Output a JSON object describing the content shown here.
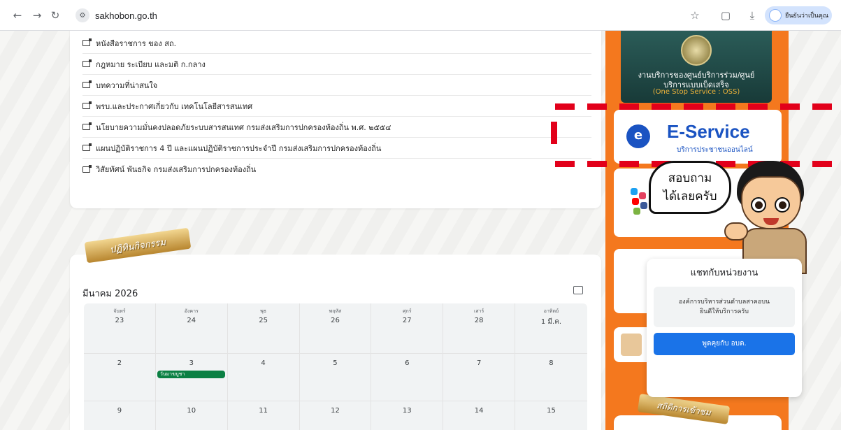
{
  "browser": {
    "url": "sakhobon.go.th",
    "profile_label": "ยืนยันว่าเป็นคุณ"
  },
  "links": [
    "หนังสือราชการ ของ สถ.",
    "กฎหมาย ระเบียบ และมติ ก.กลาง",
    "บทความที่น่าสนใจ",
    "พรบ.และประกาศเกี่ยวกับ เทคโนโลยีสารสนเทศ",
    "นโยบายความมั่นคงปลอดภัยระบบสารสนเทศ กรมส่งเสริมการปกครองท้องถิ่น พ.ศ. ๒๕๕๔",
    "แผนปฏิบัติราชการ 4 ปี และแผนปฏิบัติราชการประจำปี กรมส่งเสริมการปกครองท้องถิ่น",
    "วิสัยทัศน์ พันธกิจ กรมส่งเสริมการปกครองท้องถิ่น"
  ],
  "activity_ribbon": "ปฏิทินกิจกรรม",
  "calendar": {
    "month": "มีนาคม 2026",
    "days": [
      {
        "dow": "จันทร์",
        "d": "23"
      },
      {
        "dow": "อังคาร",
        "d": "24"
      },
      {
        "dow": "พุธ",
        "d": "25"
      },
      {
        "dow": "พฤหัส",
        "d": "26"
      },
      {
        "dow": "ศุกร์",
        "d": "27"
      },
      {
        "dow": "เสาร์",
        "d": "28"
      },
      {
        "dow": "อาทิตย์",
        "d": "1 มี.ค."
      }
    ],
    "week2": [
      "2",
      "3",
      "4",
      "5",
      "6",
      "7",
      "8"
    ],
    "week3": [
      "9",
      "10",
      "11",
      "12",
      "13",
      "14",
      "15"
    ],
    "event": "วันมาฆบูชา"
  },
  "sidebar": {
    "oss_line1": "งานบริการของศูนย์บริการร่วม/ศูนย์",
    "oss_line2": "บริการแบบเบ็ดเสร็จ",
    "oss_line3": "(One Stop Service : OSS)",
    "eservice_logo": "e",
    "eservice_title": "E-Service",
    "eservice_sub": "บริการประชาชนออนไลน์",
    "stats_ribbon": "สถิติการเข้าชม"
  },
  "chat": {
    "bubble_line1": "สอบถาม",
    "bubble_line2": "ได้เลยครับ",
    "title": "แชทกับหน่วยงาน",
    "msg_line1": "องค์การบริหารส่วนตำบลสาคอบน",
    "msg_line2": "ยินดีให้บริการครับ",
    "button": "พูดคุยกับ อบต."
  },
  "colors": {
    "sidebar_orange": "#f4781e",
    "accent_blue": "#1a73e8",
    "dash_red": "#e2001a",
    "event_green": "#0b8043"
  }
}
